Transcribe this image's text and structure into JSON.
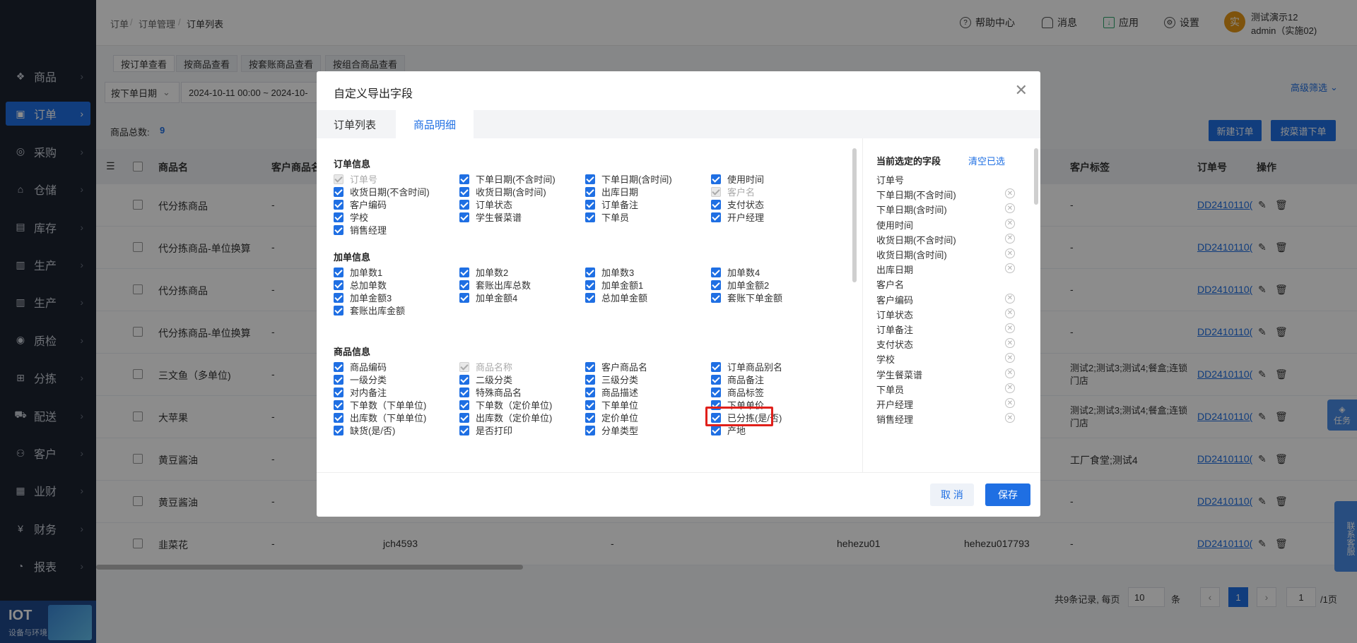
{
  "sidebar": {
    "items": [
      {
        "label": "商品",
        "icon": "goods-icon"
      },
      {
        "label": "订单",
        "icon": "order-icon"
      },
      {
        "label": "采购",
        "icon": "purchase-icon"
      },
      {
        "label": "仓储",
        "icon": "warehouse-icon"
      },
      {
        "label": "库存",
        "icon": "inventory-icon"
      },
      {
        "label": "生产",
        "icon": "production-icon"
      },
      {
        "label": "生产",
        "icon": "production-icon"
      },
      {
        "label": "质检",
        "icon": "quality-icon"
      },
      {
        "label": "分拣",
        "icon": "sorting-icon"
      },
      {
        "label": "配送",
        "icon": "delivery-icon"
      },
      {
        "label": "客户",
        "icon": "customer-icon"
      },
      {
        "label": "业财",
        "icon": "finance-icon"
      },
      {
        "label": "财务",
        "icon": "money-icon"
      },
      {
        "label": "报表",
        "icon": "report-icon"
      }
    ],
    "iot_title": "IOT",
    "iot_sub": "设备与环境"
  },
  "header": {
    "breadcrumb": [
      "订单",
      "订单管理",
      "订单列表"
    ],
    "help": "帮助中心",
    "messages": "消息",
    "apps": "应用",
    "settings": "设置",
    "avatar_char": "实",
    "user_name": "测试演示12",
    "user_account": "admin（实施02)"
  },
  "page": {
    "view_tabs": [
      "按订单查看",
      "按商品查看",
      "按套账商品查看",
      "按组合商品查看"
    ],
    "date_type": "按下单日期",
    "date_range": "2024-10-11 00:00 ~ 2024-10-",
    "advanced_filter": "高级筛选",
    "total_label": "商品总数:",
    "total_value": "9",
    "new_order": "新建订单",
    "recipe_order": "按菜谱下单",
    "columns": {
      "name": "商品名",
      "customer_goods": "客户商品名",
      "customer_tag": "客户标签",
      "order_no": "订单号",
      "actions": "操作"
    },
    "rows": [
      {
        "name": "代分拣商品",
        "cg": "-",
        "c3": "",
        "c4": "",
        "c5": "",
        "c6": "",
        "tag": "-",
        "order": "DD2410110("
      },
      {
        "name": "代分拣商品-单位换算",
        "cg": "-",
        "c3": "",
        "c4": "",
        "c5": "",
        "c6": "",
        "tag": "-",
        "order": "DD2410110("
      },
      {
        "name": "代分拣商品",
        "cg": "-",
        "c3": "",
        "c4": "",
        "c5": "",
        "c6": "",
        "tag": "-",
        "order": "DD2410110("
      },
      {
        "name": "代分拣商品-单位换算",
        "cg": "-",
        "c3": "",
        "c4": "",
        "c5": "",
        "c6": "",
        "tag": "-",
        "order": "DD2410110("
      },
      {
        "name": "三文鱼（多单位)",
        "cg": "-",
        "c3": "",
        "c4": "",
        "c5": "",
        "c6": "",
        "tag": "测试2;测试3;测试4;餐盒;连锁门店",
        "order": "DD2410110("
      },
      {
        "name": "大苹果",
        "cg": "-",
        "c3": "",
        "c4": "",
        "c5": "",
        "c6": "",
        "tag": "测试2;测试3;测试4;餐盒;连锁门店",
        "order": "DD2410110("
      },
      {
        "name": "黄豆酱油",
        "cg": "-",
        "c3": "",
        "c4": "",
        "c5": "",
        "c6": "",
        "tag": "工厂食堂;测试4",
        "order": "DD2410110("
      },
      {
        "name": "黄豆酱油",
        "cg": "-",
        "c3": "",
        "c4": "",
        "c5": "",
        "c6": "",
        "tag": "-",
        "order": "DD2410110("
      },
      {
        "name": "韭菜花",
        "cg": "-",
        "c3": "jch4593",
        "c4": "-",
        "c5": "hehezu01",
        "c6": "hehezu017793",
        "tag": "-",
        "order": "DD2410110("
      }
    ],
    "pagination": {
      "summary": "共9条记录, 每页",
      "page_size": "10",
      "unit": "条",
      "current": "1",
      "jump": "1",
      "total_pages": "/1页"
    },
    "float_task": "任务",
    "float_service": "联系客服"
  },
  "modal": {
    "title": "自定义导出字段",
    "tabs": [
      "订单列表",
      "商品明细"
    ],
    "sections": [
      {
        "title": "订单信息",
        "options": [
          {
            "label": "订单号",
            "disabled": true
          },
          {
            "label": "下单日期(不含时间)",
            "disabled": false
          },
          {
            "label": "下单日期(含时间)",
            "disabled": false
          },
          {
            "label": "使用时间",
            "disabled": false
          },
          {
            "label": "收货日期(不含时间)",
            "disabled": false
          },
          {
            "label": "收货日期(含时间)",
            "disabled": false
          },
          {
            "label": "出库日期",
            "disabled": false
          },
          {
            "label": "客户名",
            "disabled": true
          },
          {
            "label": "客户编码",
            "disabled": false
          },
          {
            "label": "订单状态",
            "disabled": false
          },
          {
            "label": "订单备注",
            "disabled": false
          },
          {
            "label": "支付状态",
            "disabled": false
          },
          {
            "label": "学校",
            "disabled": false
          },
          {
            "label": "学生餐菜谱",
            "disabled": false
          },
          {
            "label": "下单员",
            "disabled": false
          },
          {
            "label": "开户经理",
            "disabled": false
          },
          {
            "label": "销售经理",
            "disabled": false
          }
        ]
      },
      {
        "title": "加单信息",
        "options": [
          {
            "label": "加单数1",
            "disabled": false
          },
          {
            "label": "加单数2",
            "disabled": false
          },
          {
            "label": "加单数3",
            "disabled": false
          },
          {
            "label": "加单数4",
            "disabled": false
          },
          {
            "label": "总加单数",
            "disabled": false
          },
          {
            "label": "套账出库总数",
            "disabled": false
          },
          {
            "label": "加单金额1",
            "disabled": false
          },
          {
            "label": "加单金额2",
            "disabled": false
          },
          {
            "label": "加单金额3",
            "disabled": false
          },
          {
            "label": "加单金额4",
            "disabled": false
          },
          {
            "label": "总加单金额",
            "disabled": false
          },
          {
            "label": "套账下单金额",
            "disabled": false
          },
          {
            "label": "套账出库金额",
            "disabled": false
          }
        ]
      },
      {
        "title": "商品信息",
        "options": [
          {
            "label": "商品编码",
            "disabled": false
          },
          {
            "label": "商品名称",
            "disabled": true
          },
          {
            "label": "客户商品名",
            "disabled": false
          },
          {
            "label": "订单商品别名",
            "disabled": false
          },
          {
            "label": "一级分类",
            "disabled": false
          },
          {
            "label": "二级分类",
            "disabled": false
          },
          {
            "label": "三级分类",
            "disabled": false
          },
          {
            "label": "商品备注",
            "disabled": false
          },
          {
            "label": "对内备注",
            "disabled": false
          },
          {
            "label": "特殊商品名",
            "disabled": false
          },
          {
            "label": "商品描述",
            "disabled": false
          },
          {
            "label": "商品标签",
            "disabled": false
          },
          {
            "label": "下单数（下单单位)",
            "disabled": false
          },
          {
            "label": "下单数（定价单位)",
            "disabled": false
          },
          {
            "label": "下单单位",
            "disabled": false
          },
          {
            "label": "下单单价",
            "disabled": false
          },
          {
            "label": "出库数（下单单位)",
            "disabled": false
          },
          {
            "label": "出库数（定价单位)",
            "disabled": false
          },
          {
            "label": "定价单位",
            "disabled": false
          },
          {
            "label": "已分拣(是/否)",
            "disabled": false
          },
          {
            "label": "缺货(是/否)",
            "disabled": false
          },
          {
            "label": "是否打印",
            "disabled": false
          },
          {
            "label": "分单类型",
            "disabled": false
          },
          {
            "label": "产地",
            "disabled": false
          }
        ]
      }
    ],
    "selected_title": "当前选定的字段",
    "clear_label": "清空已选",
    "selected": [
      {
        "label": "订单号",
        "removable": false
      },
      {
        "label": "下单日期(不含时间)",
        "removable": true
      },
      {
        "label": "下单日期(含时间)",
        "removable": true
      },
      {
        "label": "使用时间",
        "removable": true
      },
      {
        "label": "收货日期(不含时间)",
        "removable": true
      },
      {
        "label": "收货日期(含时间)",
        "removable": true
      },
      {
        "label": "出库日期",
        "removable": true
      },
      {
        "label": "客户名",
        "removable": false
      },
      {
        "label": "客户编码",
        "removable": true
      },
      {
        "label": "订单状态",
        "removable": true
      },
      {
        "label": "订单备注",
        "removable": true
      },
      {
        "label": "支付状态",
        "removable": true
      },
      {
        "label": "学校",
        "removable": true
      },
      {
        "label": "学生餐菜谱",
        "removable": true
      },
      {
        "label": "下单员",
        "removable": true
      },
      {
        "label": "开户经理",
        "removable": true
      },
      {
        "label": "销售经理",
        "removable": true
      }
    ],
    "cancel": "取 消",
    "save": "保存"
  },
  "colors": {
    "primary": "#1f6fe3",
    "sidebar": "#1c2331",
    "highlight": "#e0201b"
  }
}
